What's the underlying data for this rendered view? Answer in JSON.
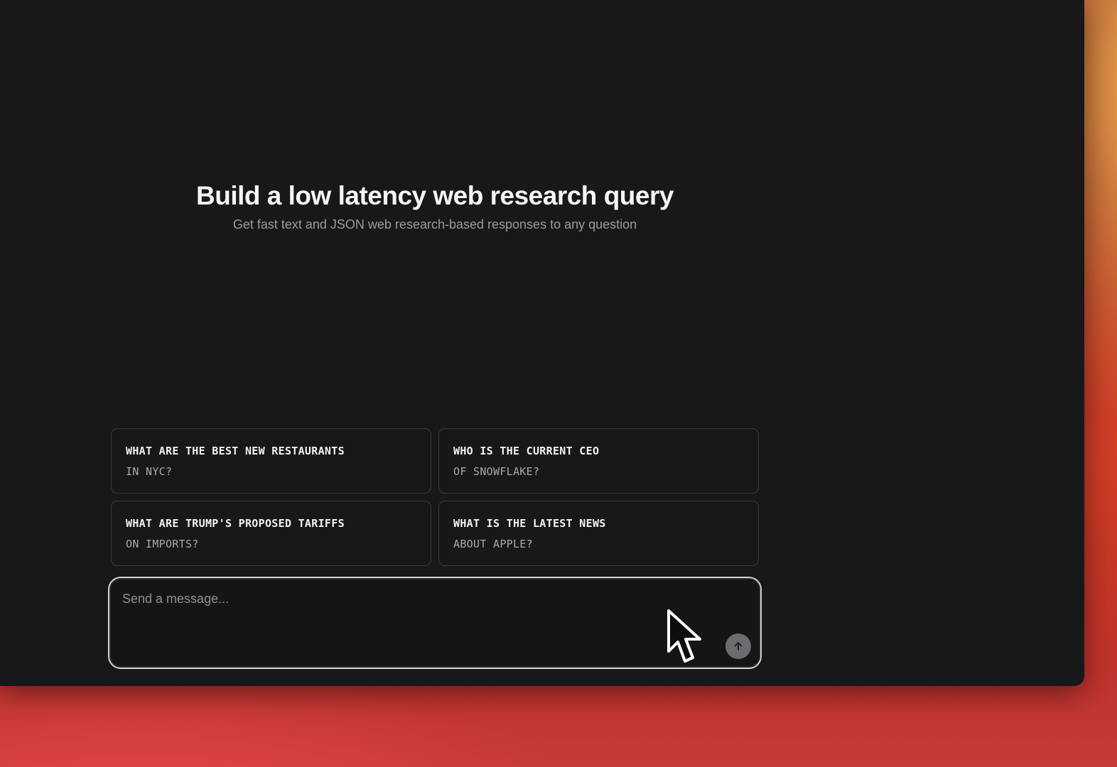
{
  "hero": {
    "title": "Build a low latency web research query",
    "subtitle": "Get fast text and JSON web research-based responses to any question"
  },
  "suggestions": [
    {
      "line1": "WHAT ARE THE BEST NEW RESTAURANTS",
      "line2": "IN NYC?"
    },
    {
      "line1": "WHO IS THE CURRENT CEO",
      "line2": "OF SNOWFLAKE?"
    },
    {
      "line1": "WHAT ARE TRUMP'S PROPOSED TARIFFS",
      "line2": "ON IMPORTS?"
    },
    {
      "line1": "WHAT IS THE LATEST NEWS",
      "line2": "ABOUT APPLE?"
    }
  ],
  "composer": {
    "placeholder": "Send a message...",
    "value": "",
    "send_icon": "arrow-up-icon"
  },
  "colors": {
    "window_background": "#18181b",
    "card_border": "#3a3a3f",
    "send_button": "#6b6b70",
    "backdrop_accent": "#b82a25"
  }
}
